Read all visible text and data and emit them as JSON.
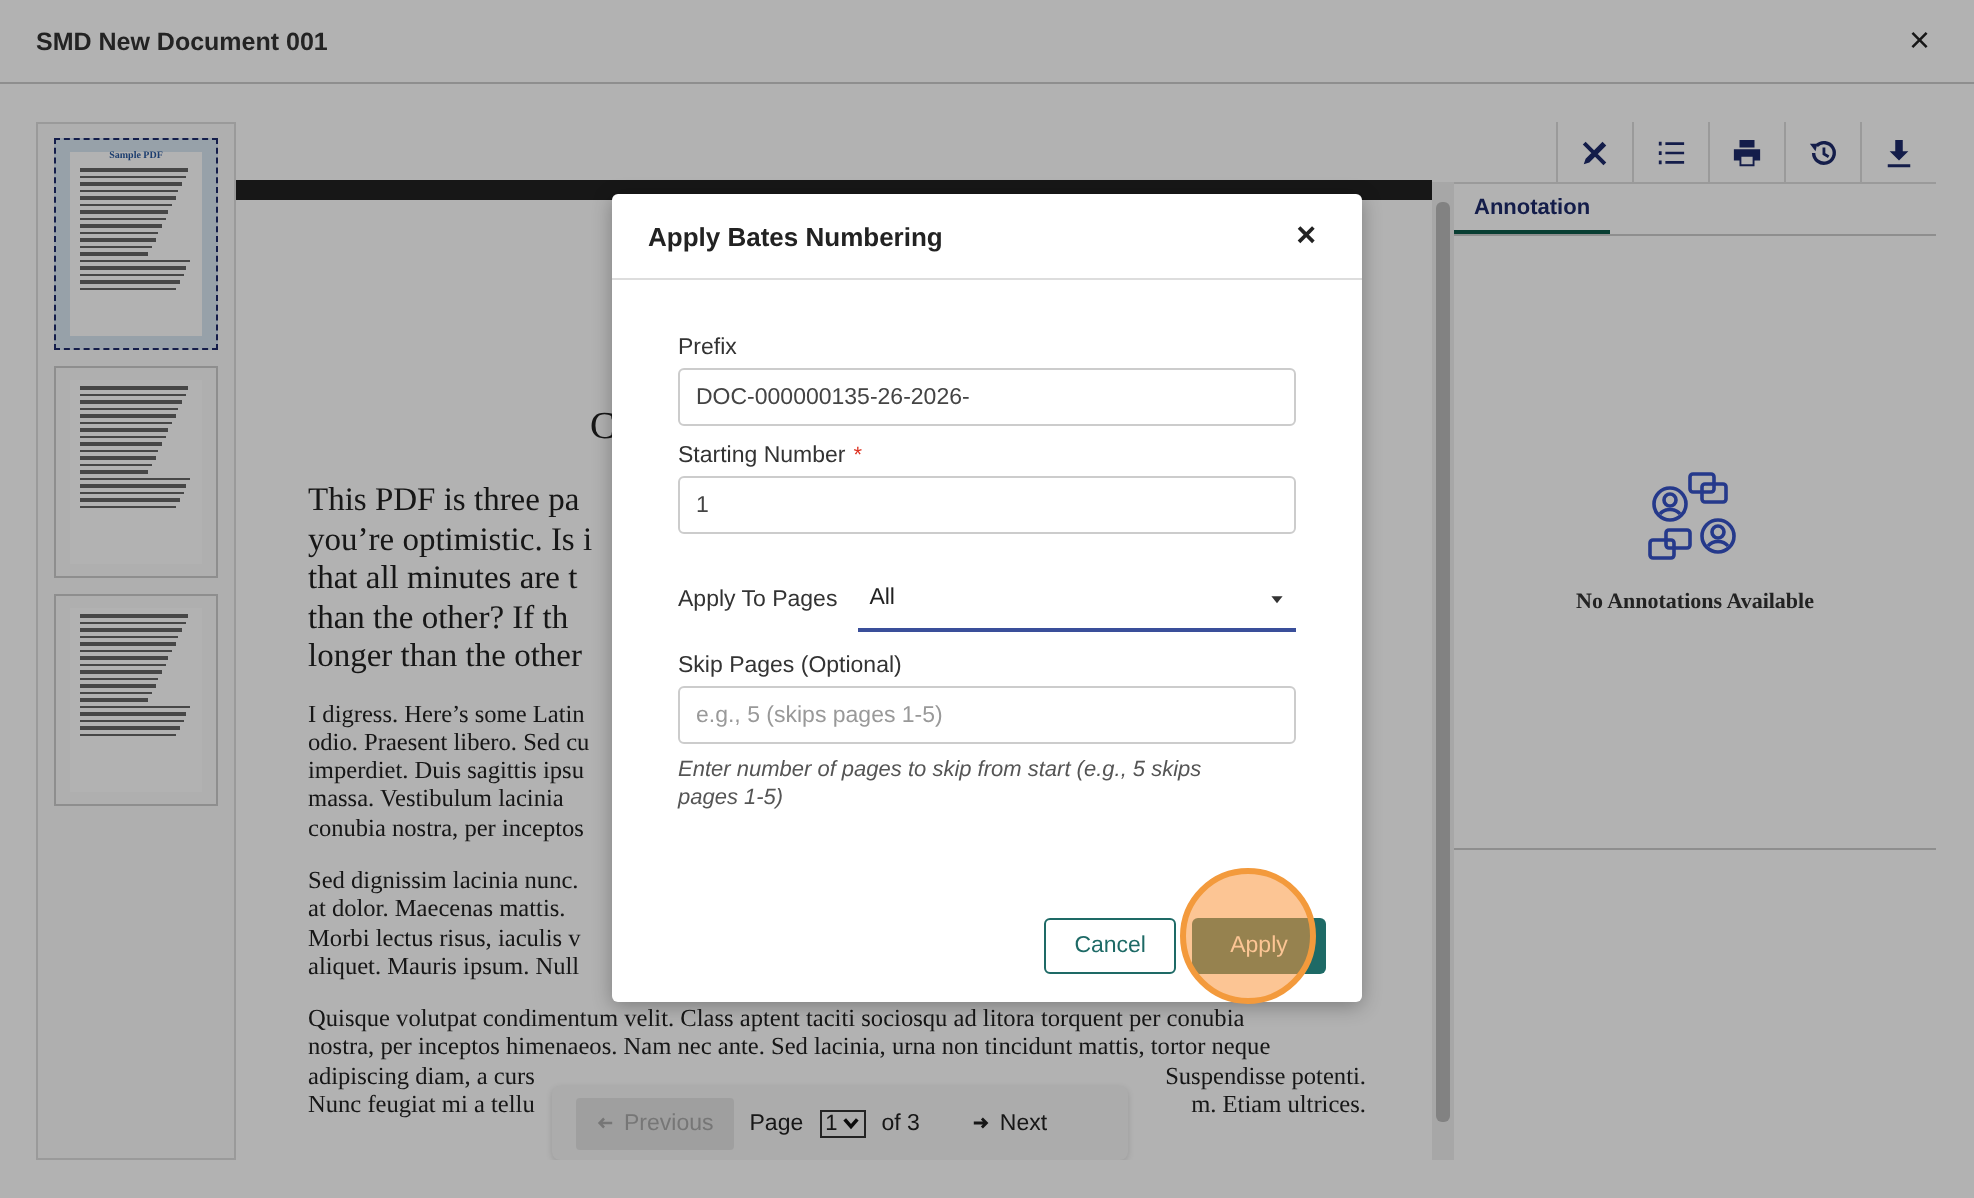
{
  "window": {
    "title": "SMD New Document 001",
    "close": "×"
  },
  "thumbnails": [
    {
      "selected": true,
      "title": "Sample PDF"
    },
    {
      "selected": false
    },
    {
      "selected": false
    }
  ],
  "document": {
    "heading": "C",
    "paragraphs": [
      {
        "kind": "large",
        "lines": [
          {
            "left": "This PDF is three pa"
          },
          {
            "left": "you’re optimistic. Is i"
          },
          {
            "left": "that all minutes are t"
          },
          {
            "left": "than the other? If th"
          },
          {
            "left": "longer than the other"
          }
        ]
      },
      {
        "kind": "small",
        "lines": [
          {
            "left": "I digress. Here’s some Latin"
          },
          {
            "left": "odio. Praesent libero. Sed cu"
          },
          {
            "left": "imperdiet. Duis sagittis ipsu"
          },
          {
            "left": "massa. Vestibulum lacinia"
          },
          {
            "left": "conubia nostra, per inceptos"
          }
        ]
      },
      {
        "kind": "small",
        "lines": [
          {
            "left": "Sed dignissim lacinia nunc."
          },
          {
            "left": "at dolor. Maecenas mattis."
          },
          {
            "left": "Morbi lectus risus, iaculis v"
          },
          {
            "left": "aliquet. Mauris ipsum. Null"
          }
        ]
      },
      {
        "kind": "small",
        "lines": [
          {
            "left": "Quisque volutpat condimentum velit. Class aptent taciti sociosqu ad litora torquent per conubia"
          },
          {
            "left": "nostra, per inceptos himenaeos. Nam nec ante. Sed lacinia, urna non tincidunt mattis, tortor neque"
          },
          {
            "left": "adipiscing diam, a curs",
            "right": "Suspendisse potenti."
          },
          {
            "left": "Nunc feugiat mi a tellu",
            "right": "m. Etiam ultrices."
          }
        ]
      }
    ]
  },
  "pager": {
    "previous": "Previous",
    "previous_disabled": true,
    "page_label": "Page",
    "page_value": "1",
    "of": "of 3",
    "next": "Next"
  },
  "annotation_panel": {
    "tabs": [
      {
        "label": "Annotation",
        "selected": true
      }
    ],
    "empty_message": "No Annotations Available"
  },
  "dialog": {
    "title": "Apply Bates Numbering",
    "close": "×",
    "fields": [
      {
        "kind": "text",
        "label": "Prefix",
        "value": "DOC-000000135-26-2026-"
      },
      {
        "kind": "text",
        "label": "Starting Number",
        "required_mark": "*",
        "value": "1"
      },
      {
        "kind": "select",
        "label": "Apply To Pages",
        "value": "All"
      },
      {
        "kind": "text",
        "label": "Skip Pages (Optional)",
        "placeholder": "e.g., 5 (skips pages 1-5)",
        "hint": "Enter number of pages to skip from start (e.g., 5 skips pages 1-5)"
      }
    ],
    "buttons": [
      {
        "kind": "secondary",
        "label": "Cancel"
      },
      {
        "kind": "primary",
        "label": "Apply"
      }
    ]
  }
}
